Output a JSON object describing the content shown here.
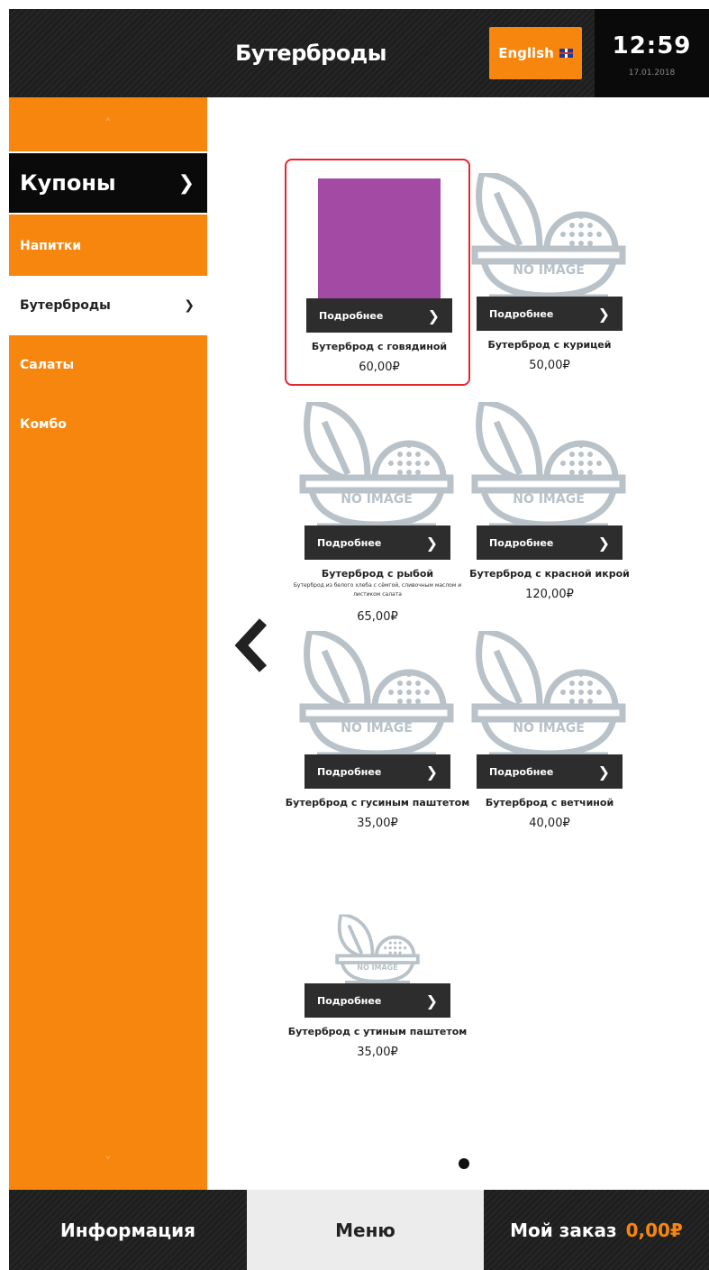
{
  "header": {
    "title": "Бутерброды",
    "language_button": "English",
    "time": "12:59",
    "date": "17.01.2018"
  },
  "sidebar": {
    "coupons_label": "Купоны",
    "categories": [
      {
        "label": "Напитки",
        "active": false
      },
      {
        "label": "Бутерброды",
        "active": true
      },
      {
        "label": "Салаты",
        "active": false
      },
      {
        "label": "Комбо",
        "active": false
      }
    ],
    "scroll_up_icon": "chevron-up-icon",
    "scroll_down_icon": "chevron-down-icon"
  },
  "products": {
    "more_label": "Подробнее",
    "placeholder_text": "NO IMAGE",
    "items": [
      {
        "name": "Бутерброд с говядиной",
        "price": "60,00₽",
        "description": ""
      },
      {
        "name": "Бутерброд с курицей",
        "price": "50,00₽",
        "description": ""
      },
      {
        "name": "Бутерброд с рыбой",
        "price": "65,00₽",
        "description": "Бутерброд из белого хлеба с сёмгой, сливочным маслом и листиком салата"
      },
      {
        "name": "Бутерброд с красной икрой",
        "price": "120,00₽",
        "description": ""
      },
      {
        "name": "Бутерброд с гусиным паштетом",
        "price": "35,00₽",
        "description": ""
      },
      {
        "name": "Бутерброд с ветчиной",
        "price": "40,00₽",
        "description": ""
      },
      {
        "name": "Бутерброд с утиным паштетом",
        "price": "35,00₽",
        "description": ""
      }
    ]
  },
  "footer": {
    "info_label": "Информация",
    "menu_label": "Меню",
    "order_label": "Мой заказ",
    "order_total": "0,00₽"
  },
  "colors": {
    "accent": "#f7860f",
    "dark": "#1e1e1e",
    "selected_border": "#e3262f",
    "swatch": "#a24aa4",
    "placeholder_gray": "#b8c2c8"
  }
}
